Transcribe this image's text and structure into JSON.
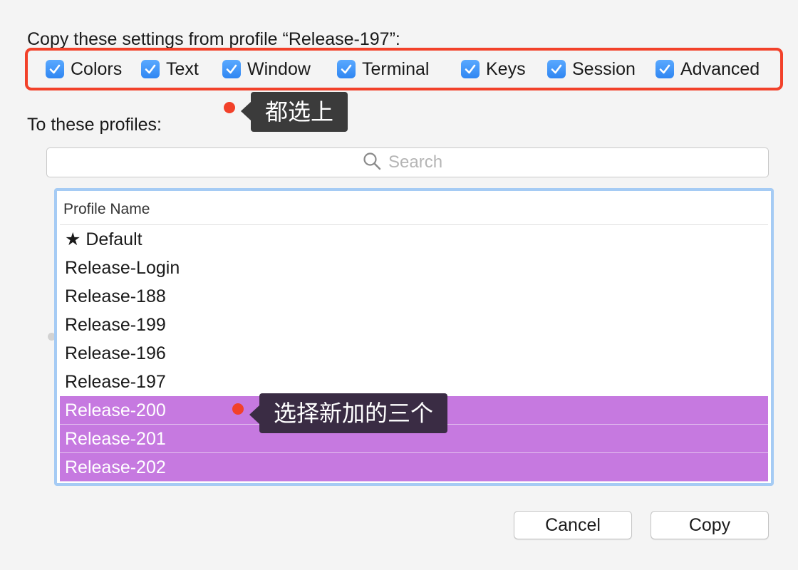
{
  "header": {
    "copy_heading": "Copy these settings from profile “Release-197”:"
  },
  "settings": [
    {
      "label": "Colors",
      "checked": true
    },
    {
      "label": "Text",
      "checked": true
    },
    {
      "label": "Window",
      "checked": true
    },
    {
      "label": "Terminal",
      "checked": true
    },
    {
      "label": "Keys",
      "checked": true
    },
    {
      "label": "Session",
      "checked": true
    },
    {
      "label": "Advanced",
      "checked": true
    }
  ],
  "annotations": {
    "select_all": "都选上",
    "select_new": "选择新加的三个",
    "color": "#f2412a"
  },
  "profiles_label": "To these profiles:",
  "search": {
    "placeholder": "Search"
  },
  "table": {
    "header": "Profile Name",
    "rows": [
      {
        "name": "★ Default",
        "selected": false
      },
      {
        "name": "Release-Login",
        "selected": false
      },
      {
        "name": "Release-188",
        "selected": false
      },
      {
        "name": "Release-199",
        "selected": false
      },
      {
        "name": "Release-196",
        "selected": false
      },
      {
        "name": "Release-197",
        "selected": false
      },
      {
        "name": "Release-200",
        "selected": true
      },
      {
        "name": "Release-201",
        "selected": true
      },
      {
        "name": "Release-202",
        "selected": true
      }
    ],
    "selection_color": "#c679e0"
  },
  "buttons": {
    "cancel": "Cancel",
    "copy": "Copy"
  },
  "colors": {
    "checkbox": "#2f86f2",
    "table_focus_ring": "#a5cbf4"
  }
}
